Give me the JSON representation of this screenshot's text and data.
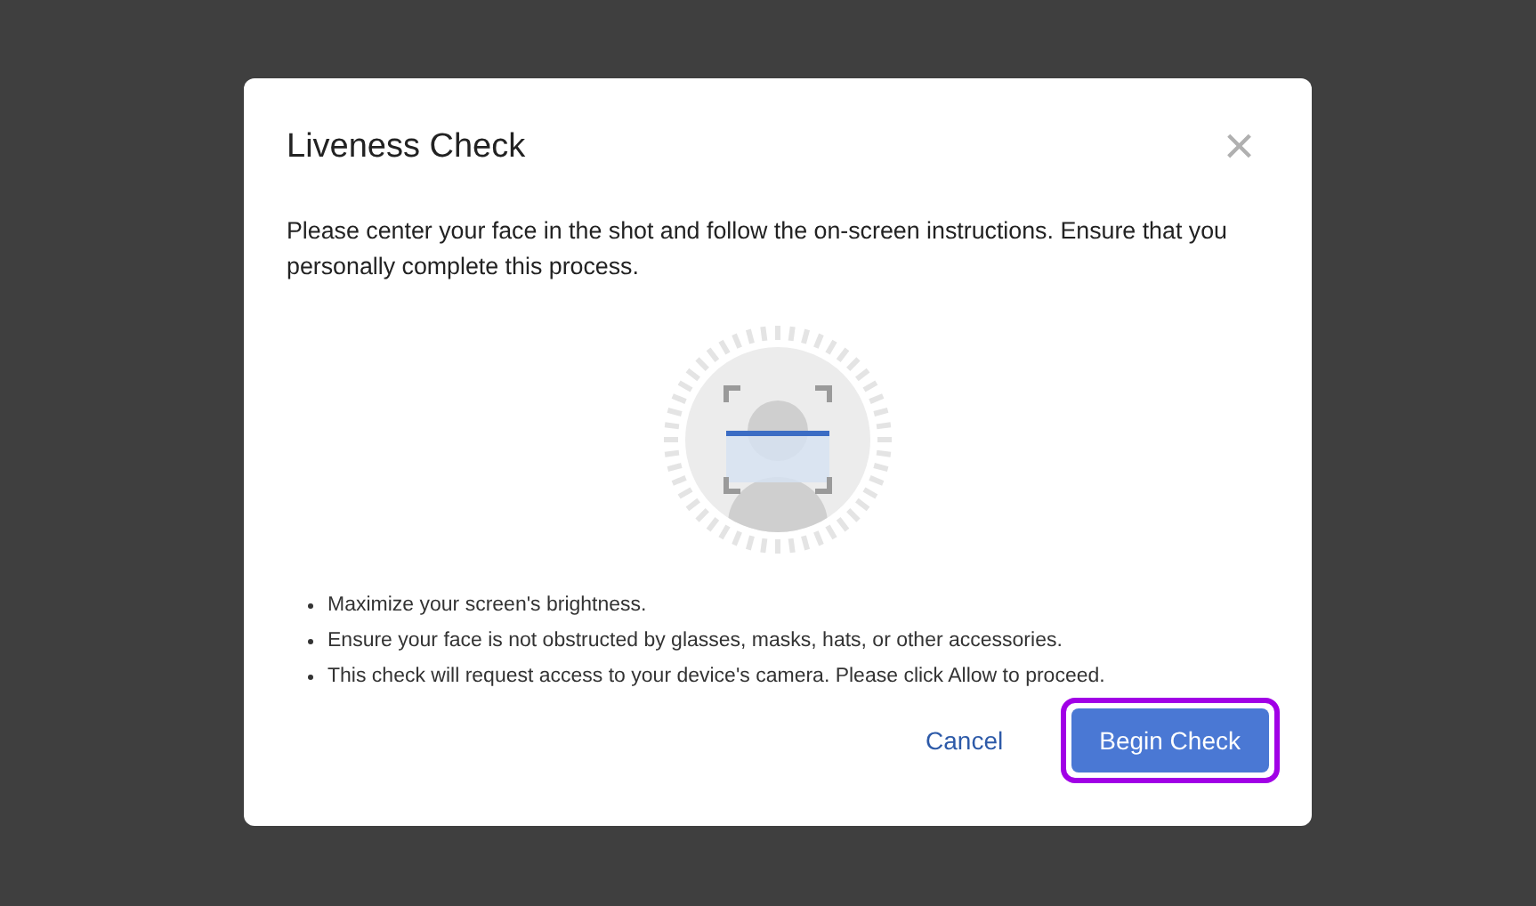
{
  "dialog": {
    "title": "Liveness Check",
    "close": "×",
    "intro": "Please center your face in the shot and follow the on-screen instructions. Ensure that you personally complete this process.",
    "tips": [
      "Maximize your screen's brightness.",
      "Ensure your face is not obstructed by glasses, masks, hats, or other accessories.",
      "This check will request access to your device's camera. Please click Allow to proceed."
    ],
    "buttons": [
      {
        "label": "Cancel",
        "kind": "text",
        "highlighted": false
      },
      {
        "label": "Begin Check",
        "kind": "primary",
        "highlighted": true
      }
    ]
  }
}
